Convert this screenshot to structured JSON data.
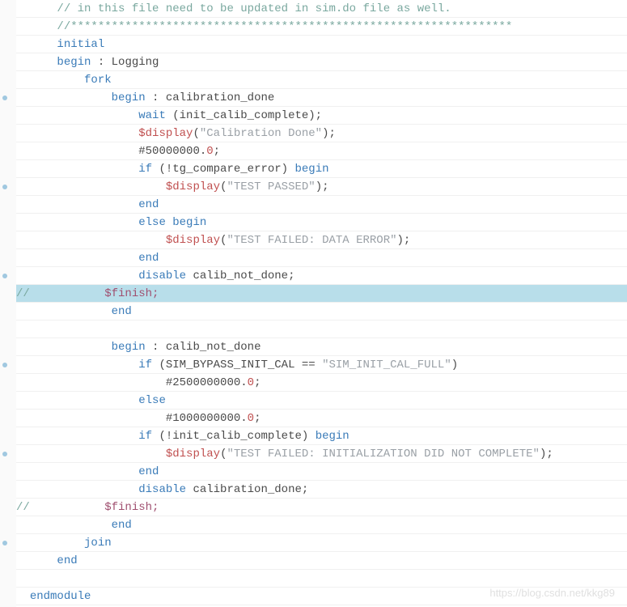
{
  "watermark": "https://blog.csdn.net/kkg89",
  "lines": [
    {
      "indent": 3,
      "hl": false,
      "tokens": [
        {
          "t": "// in this file need to be updated in sim.do file as well.",
          "c": "c-comment"
        }
      ]
    },
    {
      "indent": 3,
      "hl": false,
      "tokens": [
        {
          "t": "//*****************************************************************",
          "c": "c-comment"
        }
      ]
    },
    {
      "indent": 3,
      "hl": false,
      "tokens": [
        {
          "t": "initial",
          "c": "c-keyword"
        }
      ]
    },
    {
      "indent": 3,
      "hl": false,
      "tokens": [
        {
          "t": "begin",
          "c": "c-keyword"
        },
        {
          "t": " : Logging",
          "c": "c-text"
        }
      ]
    },
    {
      "indent": 5,
      "hl": false,
      "tokens": [
        {
          "t": "fork",
          "c": "c-keyword"
        }
      ]
    },
    {
      "indent": 7,
      "hl": false,
      "tokens": [
        {
          "t": "begin",
          "c": "c-keyword"
        },
        {
          "t": " : calibration_done",
          "c": "c-text"
        }
      ]
    },
    {
      "indent": 9,
      "hl": false,
      "tokens": [
        {
          "t": "wait",
          "c": "c-keyword"
        },
        {
          "t": " (init_calib_complete);",
          "c": "c-text"
        }
      ]
    },
    {
      "indent": 9,
      "hl": false,
      "tokens": [
        {
          "t": "$display",
          "c": "c-system"
        },
        {
          "t": "(",
          "c": "c-text"
        },
        {
          "t": "\"Calibration Done\"",
          "c": "c-string"
        },
        {
          "t": ");",
          "c": "c-text"
        }
      ]
    },
    {
      "indent": 9,
      "hl": false,
      "tokens": [
        {
          "t": "#50000000.",
          "c": "c-text"
        },
        {
          "t": "0",
          "c": "c-number"
        },
        {
          "t": ";",
          "c": "c-text"
        }
      ]
    },
    {
      "indent": 9,
      "hl": false,
      "tokens": [
        {
          "t": "if",
          "c": "c-keyword"
        },
        {
          "t": " (!tg_compare_error) ",
          "c": "c-text"
        },
        {
          "t": "begin",
          "c": "c-keyword"
        }
      ]
    },
    {
      "indent": 11,
      "hl": false,
      "tokens": [
        {
          "t": "$display",
          "c": "c-system"
        },
        {
          "t": "(",
          "c": "c-text"
        },
        {
          "t": "\"TEST PASSED\"",
          "c": "c-string"
        },
        {
          "t": ");",
          "c": "c-text"
        }
      ]
    },
    {
      "indent": 9,
      "hl": false,
      "tokens": [
        {
          "t": "end",
          "c": "c-keyword"
        }
      ]
    },
    {
      "indent": 9,
      "hl": false,
      "tokens": [
        {
          "t": "else",
          "c": "c-keyword"
        },
        {
          "t": " ",
          "c": "c-text"
        },
        {
          "t": "begin",
          "c": "c-keyword"
        }
      ]
    },
    {
      "indent": 11,
      "hl": false,
      "tokens": [
        {
          "t": "$display",
          "c": "c-system"
        },
        {
          "t": "(",
          "c": "c-text"
        },
        {
          "t": "\"TEST FAILED: DATA ERROR\"",
          "c": "c-string"
        },
        {
          "t": ");",
          "c": "c-text"
        }
      ]
    },
    {
      "indent": 9,
      "hl": false,
      "tokens": [
        {
          "t": "end",
          "c": "c-keyword"
        }
      ]
    },
    {
      "indent": 9,
      "hl": false,
      "tokens": [
        {
          "t": "disable",
          "c": "c-keyword"
        },
        {
          "t": " calib_not_done;",
          "c": "c-text"
        }
      ]
    },
    {
      "indent": 0,
      "hl": true,
      "tokens": [
        {
          "t": "//",
          "c": "c-comment"
        },
        {
          "t": "           $finish;",
          "c": "c-purple"
        }
      ]
    },
    {
      "indent": 7,
      "hl": false,
      "tokens": [
        {
          "t": "end",
          "c": "c-keyword"
        }
      ]
    },
    {
      "indent": 0,
      "hl": false,
      "tokens": [
        {
          "t": "",
          "c": "c-text"
        }
      ]
    },
    {
      "indent": 7,
      "hl": false,
      "tokens": [
        {
          "t": "begin",
          "c": "c-keyword"
        },
        {
          "t": " : calib_not_done",
          "c": "c-text"
        }
      ]
    },
    {
      "indent": 9,
      "hl": false,
      "tokens": [
        {
          "t": "if",
          "c": "c-keyword"
        },
        {
          "t": " (SIM_BYPASS_INIT_CAL == ",
          "c": "c-text"
        },
        {
          "t": "\"SIM_INIT_CAL_FULL\"",
          "c": "c-string"
        },
        {
          "t": ")",
          "c": "c-text"
        }
      ]
    },
    {
      "indent": 11,
      "hl": false,
      "tokens": [
        {
          "t": "#2500000000.",
          "c": "c-text"
        },
        {
          "t": "0",
          "c": "c-number"
        },
        {
          "t": ";",
          "c": "c-text"
        }
      ]
    },
    {
      "indent": 9,
      "hl": false,
      "tokens": [
        {
          "t": "else",
          "c": "c-keyword"
        }
      ]
    },
    {
      "indent": 11,
      "hl": false,
      "tokens": [
        {
          "t": "#1000000000.",
          "c": "c-text"
        },
        {
          "t": "0",
          "c": "c-number"
        },
        {
          "t": ";",
          "c": "c-text"
        }
      ]
    },
    {
      "indent": 9,
      "hl": false,
      "tokens": [
        {
          "t": "if",
          "c": "c-keyword"
        },
        {
          "t": " (!init_calib_complete) ",
          "c": "c-text"
        },
        {
          "t": "begin",
          "c": "c-keyword"
        }
      ]
    },
    {
      "indent": 11,
      "hl": false,
      "tokens": [
        {
          "t": "$display",
          "c": "c-system"
        },
        {
          "t": "(",
          "c": "c-text"
        },
        {
          "t": "\"TEST FAILED: INITIALIZATION DID NOT COMPLETE\"",
          "c": "c-string"
        },
        {
          "t": ");",
          "c": "c-text"
        }
      ]
    },
    {
      "indent": 9,
      "hl": false,
      "tokens": [
        {
          "t": "end",
          "c": "c-keyword"
        }
      ]
    },
    {
      "indent": 9,
      "hl": false,
      "tokens": [
        {
          "t": "disable",
          "c": "c-keyword"
        },
        {
          "t": " calibration_done;",
          "c": "c-text"
        }
      ]
    },
    {
      "indent": 0,
      "hl": false,
      "tokens": [
        {
          "t": "//",
          "c": "c-comment"
        },
        {
          "t": "           $finish;",
          "c": "c-purple"
        }
      ]
    },
    {
      "indent": 7,
      "hl": false,
      "tokens": [
        {
          "t": "end",
          "c": "c-keyword"
        }
      ]
    },
    {
      "indent": 5,
      "hl": false,
      "tokens": [
        {
          "t": "join",
          "c": "c-keyword"
        }
      ]
    },
    {
      "indent": 3,
      "hl": false,
      "tokens": [
        {
          "t": "end",
          "c": "c-keyword"
        }
      ]
    },
    {
      "indent": 0,
      "hl": false,
      "tokens": [
        {
          "t": "",
          "c": "c-text"
        }
      ]
    },
    {
      "indent": 1,
      "hl": false,
      "tokens": [
        {
          "t": "endmodule",
          "c": "c-keyword"
        }
      ]
    }
  ]
}
